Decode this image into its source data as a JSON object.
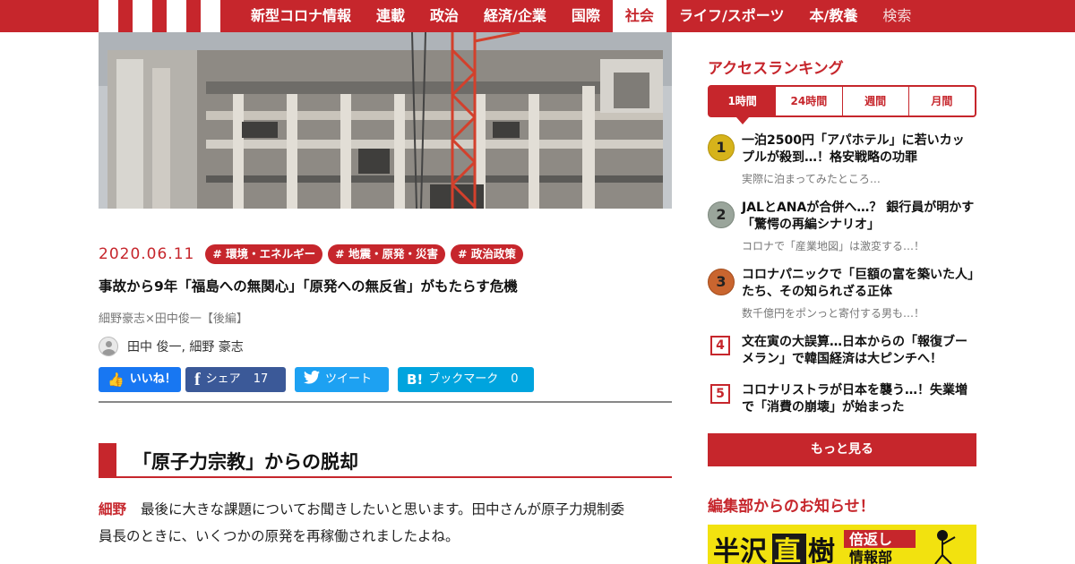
{
  "nav": {
    "items": [
      {
        "label": "新型コロナ情報"
      },
      {
        "label": "連載"
      },
      {
        "label": "政治"
      },
      {
        "label": "経済/企業"
      },
      {
        "label": "国際"
      },
      {
        "label": "社会"
      },
      {
        "label": "ライフ/スポーツ"
      },
      {
        "label": "本/教養"
      },
      {
        "label": "検索"
      }
    ],
    "active": "社会",
    "brand_color": "#c6262c"
  },
  "article": {
    "date": "2020.06.11",
    "tags": [
      "# 環境・エネルギー",
      "# 地震・原発・災害",
      "# 政治政策"
    ],
    "title": "事故から9年「福島への無関心」「原発への無反省」がもたらす危機",
    "subtitle": "細野豪志×田中俊一【後編】",
    "authors": "田中 俊一, 細野 豪志",
    "share": {
      "like_label": "いいね！",
      "fb_share_label": "シェア",
      "fb_share_count": "17",
      "tweet_label": "ツイート",
      "hatena_label": "ブックマーク",
      "hatena_count": "0"
    },
    "section_heading": "「原子力宗教」からの脱却",
    "body": {
      "speaker": "細野",
      "line1": "最後に大きな課題についてお聞きしたいと思います。田中さんが原子力規制委",
      "line2": "員長のときに、いくつかの原発を再稼働されましたよね。"
    }
  },
  "sidebar": {
    "ranking_title": "アクセスランキング",
    "tabs": [
      "1時間",
      "24時間",
      "週間",
      "月間"
    ],
    "active_tab": "1時間",
    "ranking": [
      {
        "rank": "1",
        "title": "一泊2500円「アパホテル」に若いカップルが殺到…！格安戦略の功罪",
        "sub": "実際に泊まってみたところ…"
      },
      {
        "rank": "2",
        "title": "JALとANAが合併へ…？ 銀行員が明かす「驚愕の再編シナリオ」",
        "sub": "コロナで「産業地図」は激変する…！"
      },
      {
        "rank": "3",
        "title": "コロナパニックで「巨額の富を築いた人」たち、その知られざる正体",
        "sub": "数千億円をポンっと寄付する男も…！"
      },
      {
        "rank": "4",
        "title": "文在寅の大誤算…日本からの「報復ブーメラン」で韓国経済は大ピンチへ！",
        "sub": ""
      },
      {
        "rank": "5",
        "title": "コロナリストラが日本を襲う…！失業増で「消費の崩壊」が始まった",
        "sub": ""
      }
    ],
    "more_label": "もっと見る",
    "notice_title": "編集部からのお知らせ！",
    "banner_text": "半沢直樹 倍返し 情報部"
  }
}
